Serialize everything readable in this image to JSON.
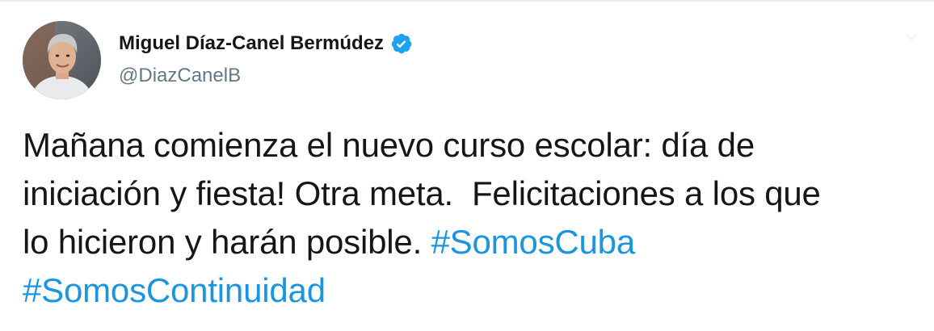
{
  "author": {
    "name": "Miguel Díaz-Canel Bermúdez",
    "handle": "@DiazCanelB",
    "verified": true
  },
  "tweet": {
    "text_line_1": "Mañana comienza el nuevo curso escolar: día de",
    "text_line_2": "iniciación y fiesta! Otra meta.  Felicitaciones a los que",
    "text_line_3": "lo hicieron y harán posible. ",
    "hashtags": [
      "#SomosCuba",
      "#SomosContinuidad"
    ]
  },
  "colors": {
    "hashtag": "#1b95e0",
    "verified_badge": "#1da1f2",
    "handle": "#657786",
    "text": "#14171a"
  },
  "icons": {
    "verified": "verified-badge-icon",
    "more": "chevron-down-icon"
  }
}
